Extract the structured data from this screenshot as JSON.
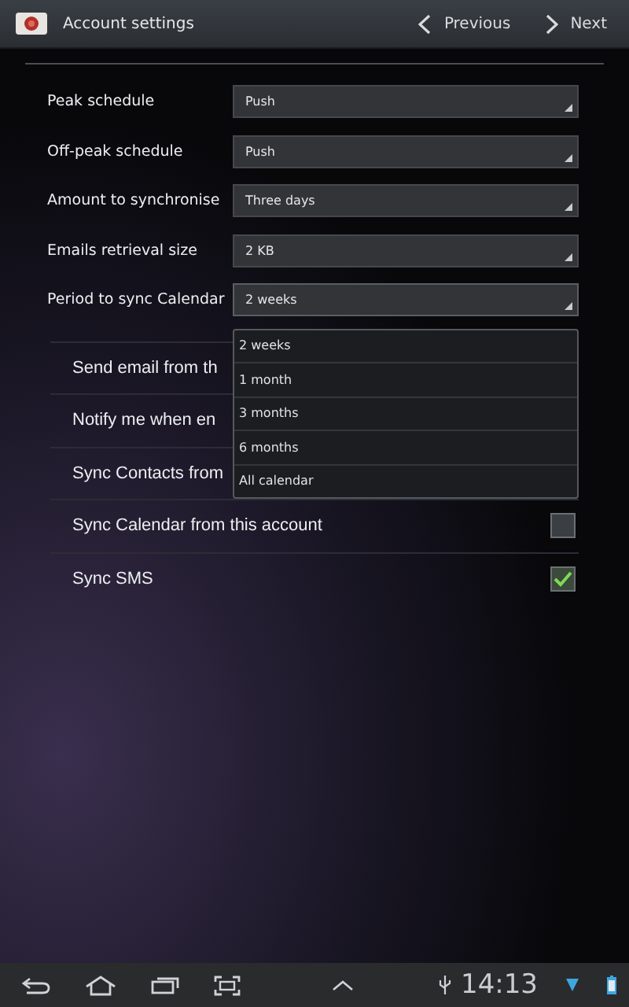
{
  "title_bar": {
    "title": "Account settings",
    "previous": "Previous",
    "next": "Next"
  },
  "dropdowns": [
    {
      "label": "Peak schedule",
      "value": "Push"
    },
    {
      "label": "Off-peak schedule",
      "value": "Push"
    },
    {
      "label": "Amount to synchronise",
      "value": "Three days"
    },
    {
      "label": "Emails retrieval size",
      "value": "2 KB"
    },
    {
      "label": "Period to sync Calendar",
      "value": "2 weeks",
      "expanded": true
    }
  ],
  "toggles": [
    {
      "label": "Send email from th"
    },
    {
      "label": "Notify me when en"
    },
    {
      "label": "Sync Contacts from"
    },
    {
      "label": "Sync Calendar from this account",
      "checked": false
    },
    {
      "label": "Sync SMS",
      "checked": true
    }
  ],
  "popup_options": [
    {
      "label": "2 weeks"
    },
    {
      "label": "1 month"
    },
    {
      "label": "3 months"
    },
    {
      "label": "6 months"
    },
    {
      "label": "All calendar"
    }
  ],
  "status_bar": {
    "time": "14:13"
  }
}
